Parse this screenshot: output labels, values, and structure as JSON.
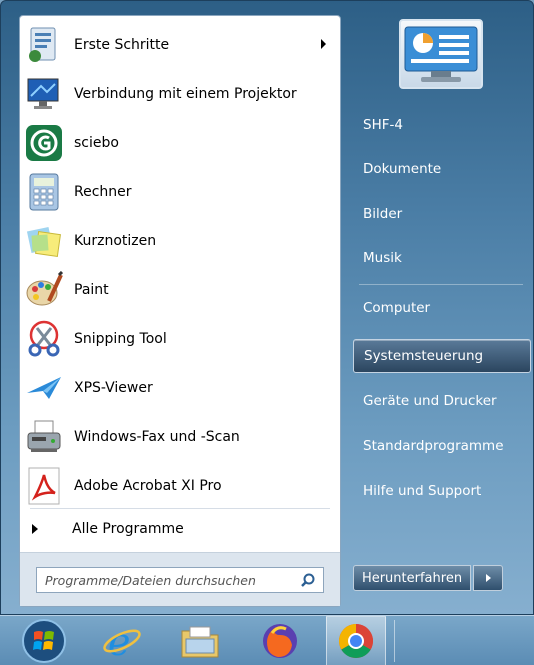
{
  "programs": [
    {
      "label": "Erste Schritte",
      "icon": "getting-started-icon",
      "has_submenu": true
    },
    {
      "label": "Verbindung mit einem Projektor",
      "icon": "projector-icon",
      "has_submenu": false
    },
    {
      "label": "sciebo",
      "icon": "sciebo-icon",
      "has_submenu": false
    },
    {
      "label": "Rechner",
      "icon": "calculator-icon",
      "has_submenu": false
    },
    {
      "label": "Kurznotizen",
      "icon": "sticky-notes-icon",
      "has_submenu": false
    },
    {
      "label": "Paint",
      "icon": "paint-icon",
      "has_submenu": false
    },
    {
      "label": "Snipping Tool",
      "icon": "snipping-tool-icon",
      "has_submenu": false
    },
    {
      "label": "XPS-Viewer",
      "icon": "xps-viewer-icon",
      "has_submenu": false
    },
    {
      "label": "Windows-Fax und -Scan",
      "icon": "fax-scan-icon",
      "has_submenu": false
    },
    {
      "label": "Adobe Acrobat XI Pro",
      "icon": "acrobat-icon",
      "has_submenu": false
    }
  ],
  "all_programs": "Alle Programme",
  "search": {
    "placeholder": "Programme/Dateien durchsuchen"
  },
  "right_items": [
    {
      "label": "SHF-4",
      "selected": false
    },
    {
      "label": "Dokumente",
      "selected": false
    },
    {
      "label": "Bilder",
      "selected": false
    },
    {
      "label": "Musik",
      "selected": false
    },
    {
      "label": "Computer",
      "selected": false
    },
    {
      "label": "Systemsteuerung",
      "selected": true
    },
    {
      "label": "Geräte und Drucker",
      "selected": false
    },
    {
      "label": "Standardprogramme",
      "selected": false
    },
    {
      "label": "Hilfe und Support",
      "selected": false
    }
  ],
  "shutdown_label": "Herunterfahren",
  "taskbar": [
    {
      "icon": "windows-start-icon"
    },
    {
      "icon": "internet-explorer-icon"
    },
    {
      "icon": "file-explorer-icon"
    },
    {
      "icon": "firefox-icon"
    },
    {
      "icon": "chrome-icon",
      "active": true
    }
  ]
}
